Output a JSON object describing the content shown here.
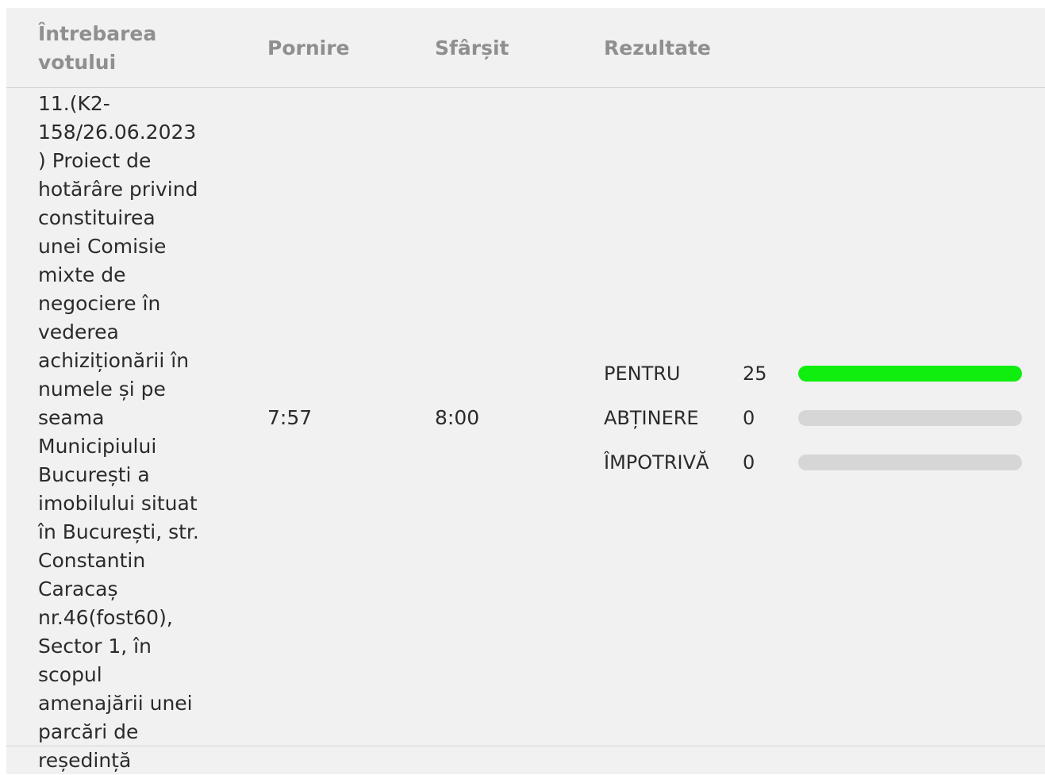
{
  "table": {
    "headers": {
      "question": "Întrebarea votului",
      "start": "Pornire",
      "end": "Sfârșit",
      "results": "Rezultate"
    },
    "rows": [
      {
        "question": "11.(K2-158/26.06.2023) Proiect de hotărâre privind constituirea unei Comisie mixte de negociere în vederea achiziționării în numele și pe seama Municipiului București a imobilului situat în București, str. Constantin Caracaș nr.46(fost60), Sector 1, în scopul amenajării unei parcări de reședință",
        "start": "7:57",
        "end": "8:00",
        "results": [
          {
            "label": "PENTRU",
            "count": "25",
            "fraction": 1.0,
            "color": "#10ee10"
          },
          {
            "label": "ABȚINERE",
            "count": "0",
            "fraction": 0.0,
            "color": "#10ee10"
          },
          {
            "label": "ÎMPOTRIVĂ",
            "count": "0",
            "fraction": 0.0,
            "color": "#10ee10"
          }
        ]
      }
    ]
  },
  "colors": {
    "panel_background": "#f1f1f1",
    "header_text": "#8f8f8f",
    "body_text": "#2b2b2b",
    "bar_track": "#d6d6d6",
    "bar_fill": "#10ee10"
  }
}
